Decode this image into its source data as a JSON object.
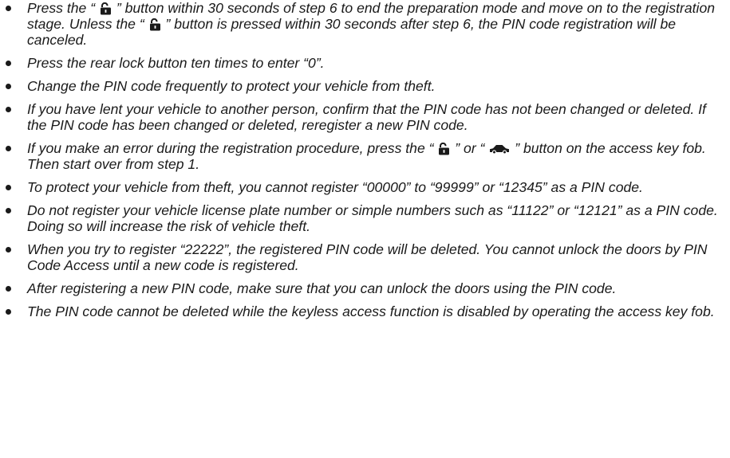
{
  "notes": [
    {
      "segments": [
        {
          "text": "Press the “"
        },
        {
          "icon": "unlock-icon"
        },
        {
          "text": "” button within 30 seconds of step 6 to end the preparation mode and move on to the registration stage. Unless the “"
        },
        {
          "icon": "unlock-icon"
        },
        {
          "text": "” button is pressed within 30 seconds after step 6, the PIN code registration will be canceled."
        }
      ]
    },
    {
      "segments": [
        {
          "text": "Press the rear lock button ten times to enter “0”."
        }
      ]
    },
    {
      "segments": [
        {
          "text": "Change the PIN code frequently to protect your vehicle from theft."
        }
      ]
    },
    {
      "segments": [
        {
          "text": "If you have lent your vehicle to another person, confirm that the PIN code has not been changed or deleted. If the PIN code has been changed or deleted, reregister a new PIN code."
        }
      ]
    },
    {
      "segments": [
        {
          "text": "If you make an error during the registration procedure, press the “"
        },
        {
          "icon": "unlock-icon"
        },
        {
          "text": "” or “"
        },
        {
          "icon": "car-icon"
        },
        {
          "text": "” button on the access key fob. Then start over from step 1."
        }
      ]
    },
    {
      "segments": [
        {
          "text": "To protect your vehicle from theft, you cannot register “00000” to “99999” or “12345” as a PIN code."
        }
      ]
    },
    {
      "segments": [
        {
          "text": "Do not register your vehicle license plate number or simple numbers such as “11122” or “12121” as a PIN code. Doing so will increase the risk of vehicle theft."
        }
      ]
    },
    {
      "segments": [
        {
          "text": "When you try to register “22222”, the registered PIN code will be deleted. You cannot unlock the doors by PIN Code Access until a new code is registered."
        }
      ]
    },
    {
      "segments": [
        {
          "text": "After registering a new PIN code, make sure that you can unlock the doors using the PIN code."
        }
      ]
    },
    {
      "segments": [
        {
          "text": "The PIN code cannot be deleted while the keyless access function is disabled by operating the access key fob."
        }
      ]
    }
  ]
}
